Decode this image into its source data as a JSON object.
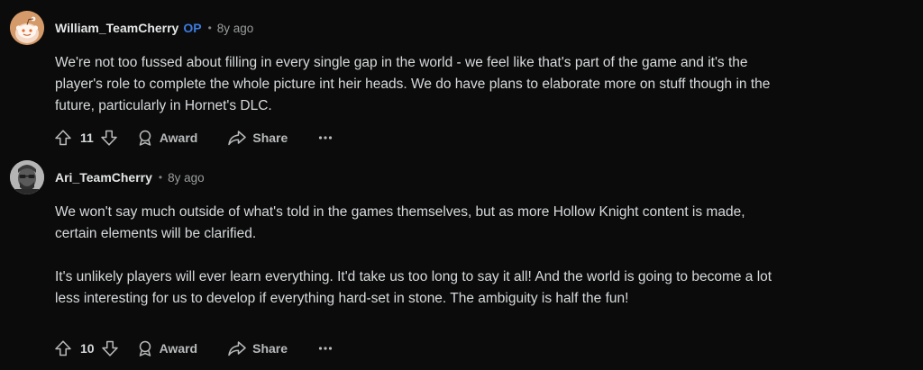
{
  "comments": [
    {
      "author": "William_TeamCherry",
      "op_badge": "OP",
      "separator": "•",
      "time": "8y ago",
      "avatar": "snoo-avatar",
      "paragraphs": [
        "We're not too fussed about filling in every single gap in the world - we feel like that's part of the game and it's the player's role to complete the whole picture int heir heads. We do have plans to elaborate more on stuff though in the future, particularly in Hornet's DLC."
      ],
      "score": "11",
      "award_label": "Award",
      "share_label": "Share",
      "more_label": "···"
    },
    {
      "author": "Ari_TeamCherry",
      "separator": "•",
      "time": "8y ago",
      "avatar": "profile-photo-avatar",
      "paragraphs": [
        "We won't say much outside of what's told in the games themselves, but as more Hollow Knight content is made, certain elements will be clarified.",
        "It's unlikely players will ever learn everything. It'd take us too long to say it all! And the world is going to become a lot less interesting for us to develop if everything hard-set in stone. The ambiguity is half the fun!"
      ],
      "score": "10",
      "award_label": "Award",
      "share_label": "Share",
      "more_label": "···"
    }
  ],
  "colors": {
    "background": "#0b0b0b",
    "text": "#d7dadc",
    "muted": "#9a9c9d",
    "op_badge": "#3c7be0",
    "avatar_orange": "#e37b2f"
  },
  "icons": [
    "upvote-icon",
    "downvote-icon",
    "award-icon",
    "share-icon",
    "more-icon"
  ]
}
